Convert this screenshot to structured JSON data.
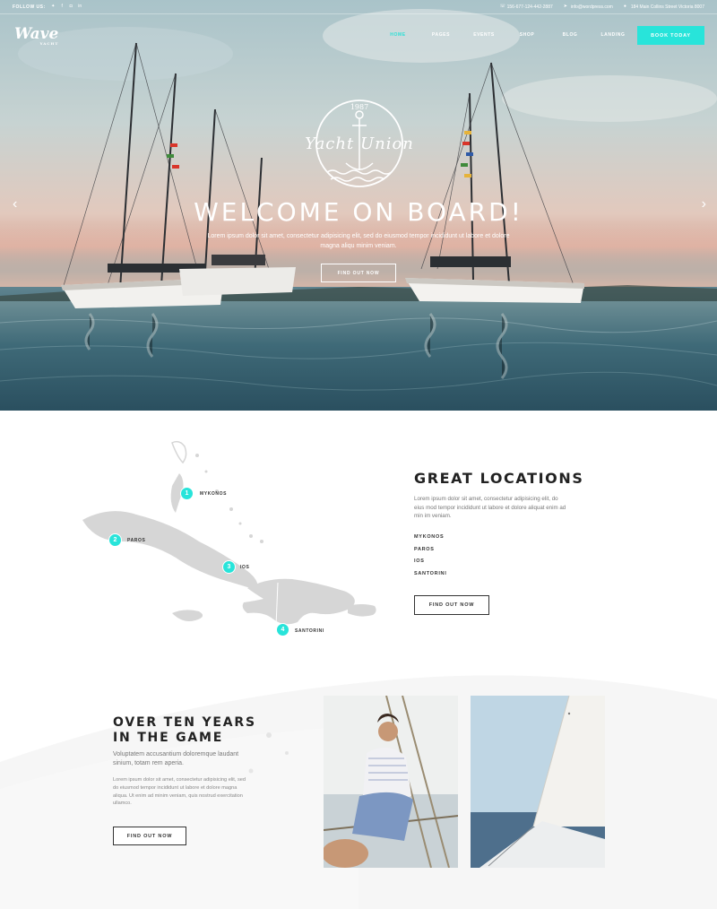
{
  "topbar": {
    "follow_label": "FOLLOW US:",
    "social_icons": [
      "twitter-icon",
      "facebook-icon",
      "instagram-icon",
      "linkedin-icon"
    ],
    "phone": "156-677-124-442-2887",
    "email": "info@wordpress.com",
    "address": "184 Main Collins Street Victoria 8007"
  },
  "header": {
    "logo_text": "Wave",
    "logo_sub": "YACHT",
    "nav": [
      "HOME",
      "PAGES",
      "EVENTS",
      "SHOP",
      "BLOG",
      "LANDING"
    ],
    "active_nav": "HOME",
    "book_label": "BOOK TODAY"
  },
  "hero": {
    "badge_year": "1987",
    "badge_brand": "Yacht Union",
    "title": "WELCOME ON BOARD!",
    "subtitle": "Lorem ipsum dolor sit amet, consectetur adipisicing elit, sed do eiusmod tempor incididunt ut labore et dolore magna aliqu minim veniam.",
    "button": "FIND OUT NOW",
    "prev_arrow": "‹",
    "next_arrow": "›"
  },
  "locations": {
    "title": "GREAT LOCATIONS",
    "text": "Lorem ipsum dolor sit amet, consectetur adipisicing elit, do eius mod tempor incididunt ut labore et dolore aliquat enim ad min im veniam.",
    "items": [
      "MYKONOS",
      "PAROS",
      "IOS",
      "SANTORINI"
    ],
    "pins": [
      {
        "num": "1",
        "label": "MYKONOS"
      },
      {
        "num": "2",
        "label": "PAROS"
      },
      {
        "num": "3",
        "label": "IOS"
      },
      {
        "num": "4",
        "label": "SANTORINI"
      }
    ],
    "button": "FIND OUT NOW"
  },
  "about": {
    "title_line1": "OVER TEN YEARS",
    "title_line2": "IN THE GAME",
    "lead": "Voluptatem accusantium doloremque laudant sinium, totam rem aperia.",
    "text": "Lorem ipsum dolor sit amet, consectetur adipisicing elit, sed do eiusmod tempor incididunt ut labore et dolore magna aliqua. Ut enim ad minim veniam, quis nostrud exercitation ullamco.",
    "button": "FIND OUT NOW"
  },
  "colors": {
    "accent": "#28e4da",
    "text_dark": "#222222",
    "text_muted": "#777777"
  }
}
